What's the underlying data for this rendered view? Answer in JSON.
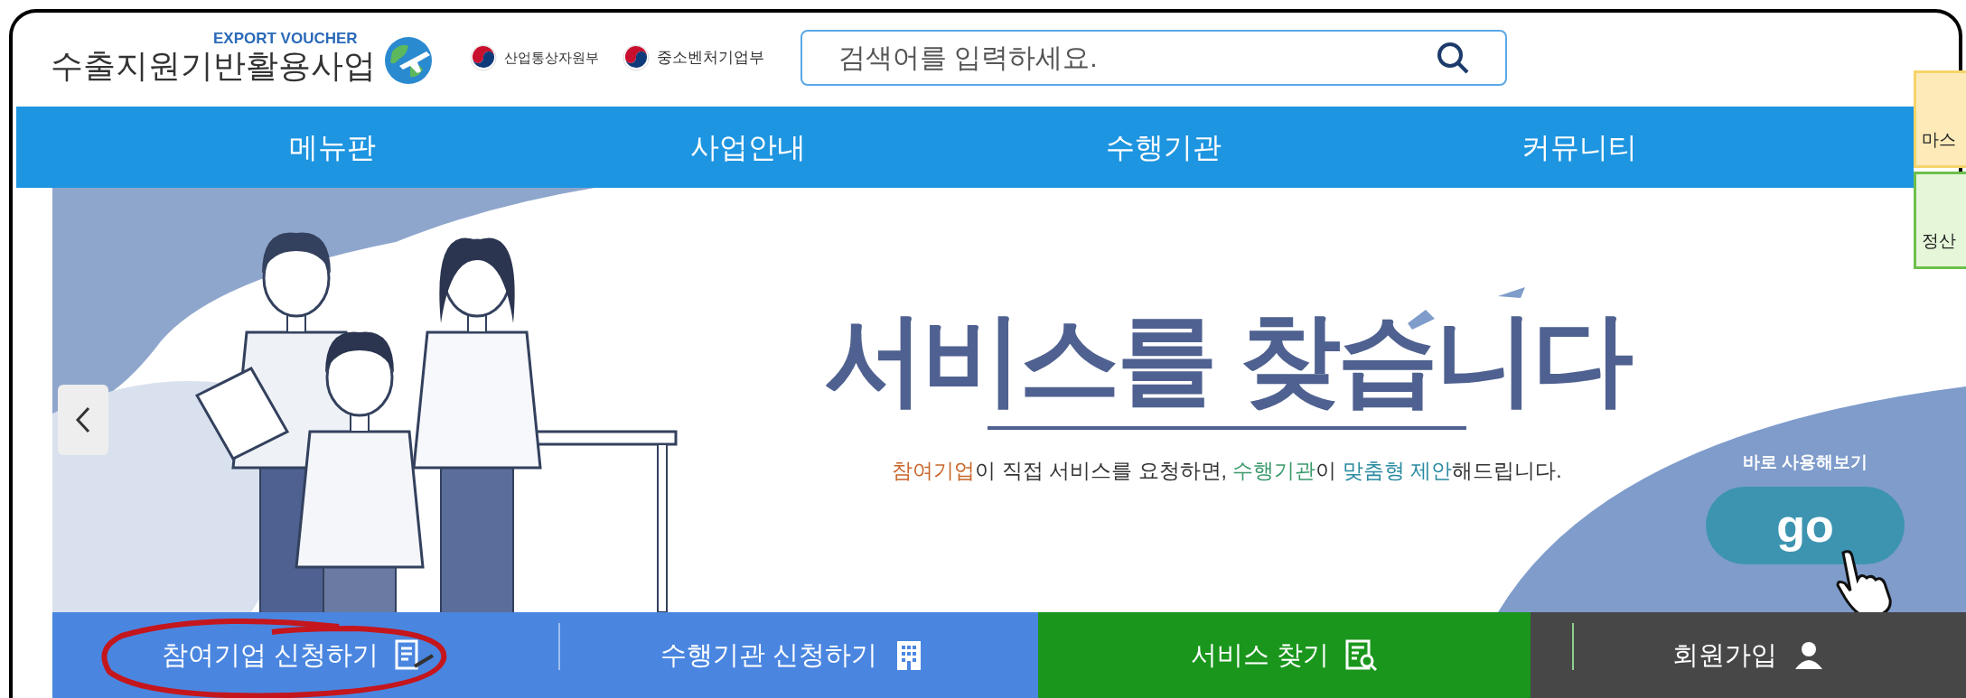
{
  "logo": {
    "caption": "EXPORT VOUCHER",
    "title": "수출지원기반활용사업"
  },
  "ministries": [
    "산업통상자원부",
    "중소벤처기업부"
  ],
  "search": {
    "placeholder": "검색어를 입력하세요."
  },
  "nav": [
    "메뉴판",
    "사업안내",
    "수행기관",
    "커뮤니티"
  ],
  "side_tabs": [
    {
      "label": "마스",
      "color": "#fdeab8"
    },
    {
      "label": "정산",
      "color": "#e6f7d9"
    }
  ],
  "banner": {
    "headline": "서비스를 찾습니다",
    "subtitle": [
      {
        "text": "참여기업",
        "color": "#c8672a"
      },
      {
        "text": "이 직접 서비스를 요청하면, "
      },
      {
        "text": "수행기관",
        "color": "#3b9a6b"
      },
      {
        "text": "이 "
      },
      {
        "text": "맞춤형 제안",
        "color": "#2a8aa0"
      },
      {
        "text": "해드립니다."
      }
    ],
    "cta_label": "바로 사용해보기",
    "cta_button": "go"
  },
  "quick_links": [
    {
      "label": "참여기업 신청하기",
      "kind": "document",
      "color": "#4a86e0",
      "circled": true
    },
    {
      "label": "수행기관 신청하기",
      "kind": "building",
      "color": "#4a86e0",
      "circled": false
    },
    {
      "label": "서비스 찾기",
      "kind": "search-document",
      "color": "#1a961c",
      "circled": false
    },
    {
      "label": "회원가입",
      "kind": "user",
      "color": "#474747",
      "circled": false
    }
  ]
}
